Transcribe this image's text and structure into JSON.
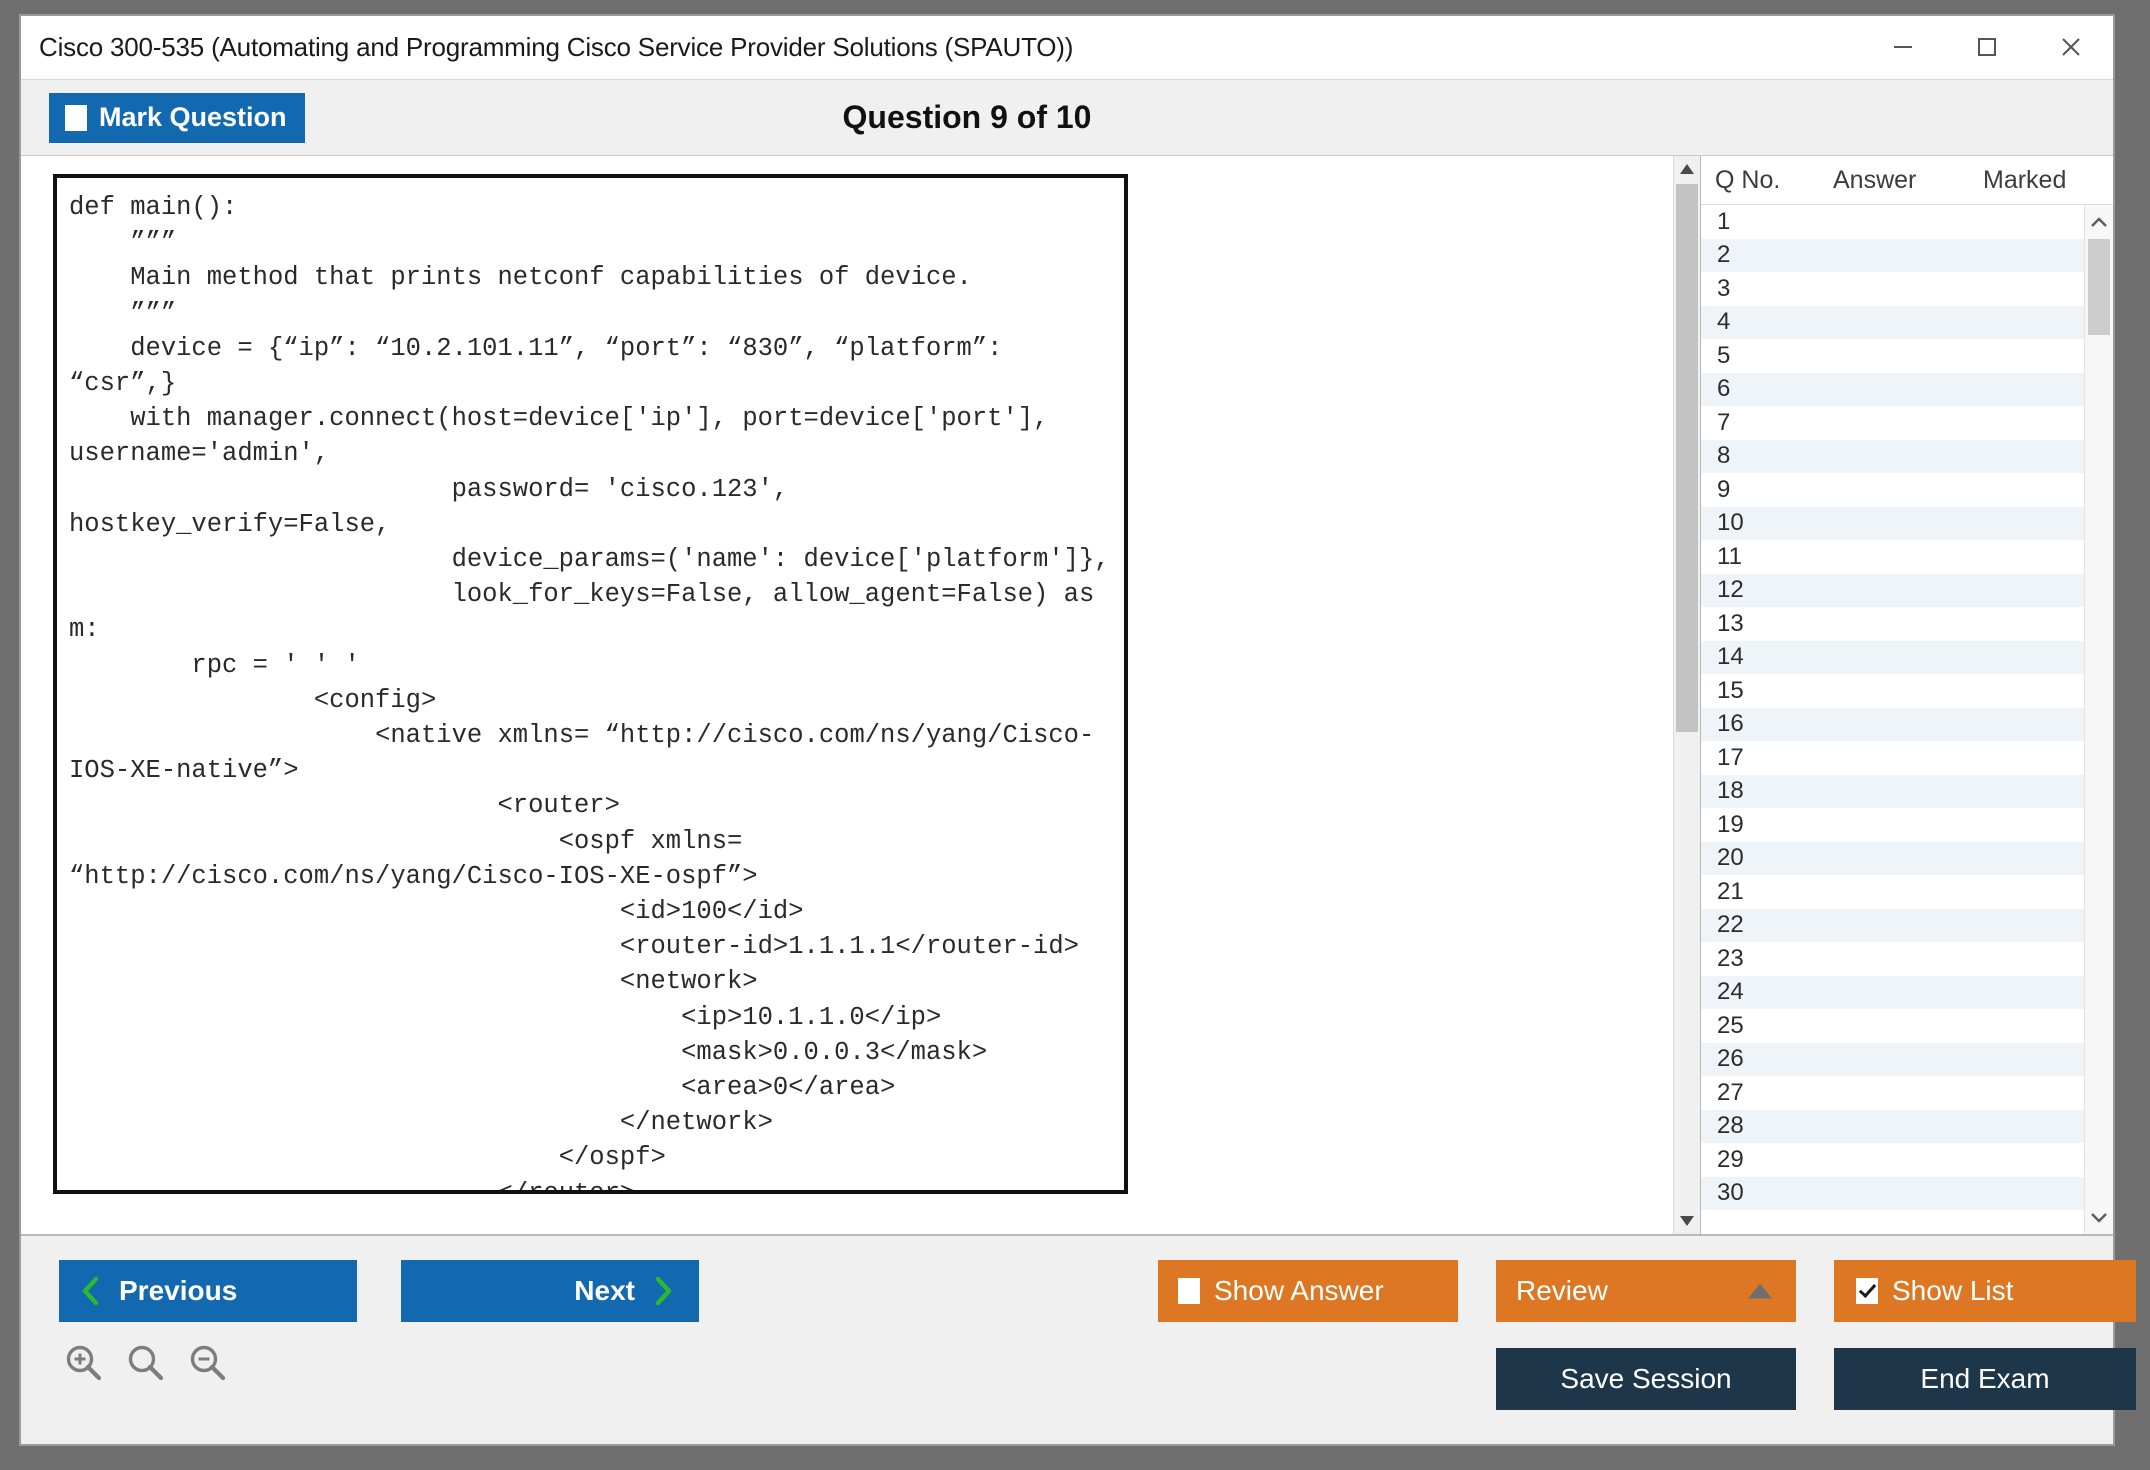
{
  "window": {
    "title": "Cisco 300-535 (Automating and Programming Cisco Service Provider Solutions (SPAUTO))",
    "controls": {
      "minimize": "minimize-icon",
      "maximize": "maximize-icon",
      "close": "close-icon"
    }
  },
  "header": {
    "mark_question_label": "Mark Question",
    "mark_question_checked": false,
    "question_title": "Question 9 of 10"
  },
  "question": {
    "code": "def main():\n    ”””\n    Main method that prints netconf capabilities of device.\n    ”””\n    device = {“ip”: “10.2.101.11”, “port”: “830”, “platform”: “csr”,}\n    with manager.connect(host=device['ip'], port=device['port'], username='admin',\n                         password= 'cisco.123', hostkey_verify=False,\n                         device_params=('name': device['platform']},\n                         look_for_keys=False, allow_agent=False) as m:\n        rpc = ' ' '\n                <config>\n                    <native xmlns= “http://cisco.com/ns/yang/Cisco-IOS-XE-native”>\n                            <router>\n                                <ospf xmlns= “http://cisco.com/ns/yang/Cisco-IOS-XE-ospf”>\n                                    <id>100</id>\n                                    <router-id>1.1.1.1</router-id>\n                                    <network>\n                                        <ip>10.1.1.0</ip>\n                                        <mask>0.0.0.3</mask>\n                                        <area>0</area>\n                                    </network>\n                                </ospf>\n                            </router>"
  },
  "list": {
    "columns": [
      "Q No.",
      "Answer",
      "Marked"
    ],
    "rows": [
      {
        "no": "1",
        "answer": "",
        "marked": ""
      },
      {
        "no": "2",
        "answer": "",
        "marked": ""
      },
      {
        "no": "3",
        "answer": "",
        "marked": ""
      },
      {
        "no": "4",
        "answer": "",
        "marked": ""
      },
      {
        "no": "5",
        "answer": "",
        "marked": ""
      },
      {
        "no": "6",
        "answer": "",
        "marked": ""
      },
      {
        "no": "7",
        "answer": "",
        "marked": ""
      },
      {
        "no": "8",
        "answer": "",
        "marked": ""
      },
      {
        "no": "9",
        "answer": "",
        "marked": ""
      },
      {
        "no": "10",
        "answer": "",
        "marked": ""
      },
      {
        "no": "11",
        "answer": "",
        "marked": ""
      },
      {
        "no": "12",
        "answer": "",
        "marked": ""
      },
      {
        "no": "13",
        "answer": "",
        "marked": ""
      },
      {
        "no": "14",
        "answer": "",
        "marked": ""
      },
      {
        "no": "15",
        "answer": "",
        "marked": ""
      },
      {
        "no": "16",
        "answer": "",
        "marked": ""
      },
      {
        "no": "17",
        "answer": "",
        "marked": ""
      },
      {
        "no": "18",
        "answer": "",
        "marked": ""
      },
      {
        "no": "19",
        "answer": "",
        "marked": ""
      },
      {
        "no": "20",
        "answer": "",
        "marked": ""
      },
      {
        "no": "21",
        "answer": "",
        "marked": ""
      },
      {
        "no": "22",
        "answer": "",
        "marked": ""
      },
      {
        "no": "23",
        "answer": "",
        "marked": ""
      },
      {
        "no": "24",
        "answer": "",
        "marked": ""
      },
      {
        "no": "25",
        "answer": "",
        "marked": ""
      },
      {
        "no": "26",
        "answer": "",
        "marked": ""
      },
      {
        "no": "27",
        "answer": "",
        "marked": ""
      },
      {
        "no": "28",
        "answer": "",
        "marked": ""
      },
      {
        "no": "29",
        "answer": "",
        "marked": ""
      },
      {
        "no": "30",
        "answer": "",
        "marked": ""
      }
    ]
  },
  "footer": {
    "previous_label": "Previous",
    "next_label": "Next",
    "show_answer_label": "Show Answer",
    "show_answer_checked": false,
    "review_label": "Review",
    "show_list_label": "Show List",
    "show_list_checked": true,
    "save_session_label": "Save Session",
    "end_exam_label": "End Exam",
    "zoom_in_icon": "zoom-in-icon",
    "zoom_reset_icon": "zoom-reset-icon",
    "zoom_out_icon": "zoom-out-icon"
  },
  "colors": {
    "blue": "#1369b0",
    "orange": "#dd7723",
    "navy": "#1d3649",
    "green_chevron": "#2eb82e",
    "row_alt": "#eff4f8"
  }
}
